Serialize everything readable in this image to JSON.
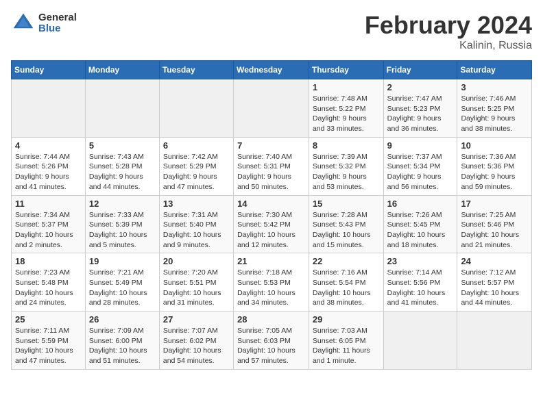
{
  "header": {
    "logo_general": "General",
    "logo_blue": "Blue",
    "title": "February 2024",
    "location": "Kalinin, Russia"
  },
  "weekdays": [
    "Sunday",
    "Monday",
    "Tuesday",
    "Wednesday",
    "Thursday",
    "Friday",
    "Saturday"
  ],
  "weeks": [
    [
      {
        "day": "",
        "info": ""
      },
      {
        "day": "",
        "info": ""
      },
      {
        "day": "",
        "info": ""
      },
      {
        "day": "",
        "info": ""
      },
      {
        "day": "1",
        "info": "Sunrise: 7:48 AM\nSunset: 5:22 PM\nDaylight: 9 hours\nand 33 minutes."
      },
      {
        "day": "2",
        "info": "Sunrise: 7:47 AM\nSunset: 5:23 PM\nDaylight: 9 hours\nand 36 minutes."
      },
      {
        "day": "3",
        "info": "Sunrise: 7:46 AM\nSunset: 5:25 PM\nDaylight: 9 hours\nand 38 minutes."
      }
    ],
    [
      {
        "day": "4",
        "info": "Sunrise: 7:44 AM\nSunset: 5:26 PM\nDaylight: 9 hours\nand 41 minutes."
      },
      {
        "day": "5",
        "info": "Sunrise: 7:43 AM\nSunset: 5:28 PM\nDaylight: 9 hours\nand 44 minutes."
      },
      {
        "day": "6",
        "info": "Sunrise: 7:42 AM\nSunset: 5:29 PM\nDaylight: 9 hours\nand 47 minutes."
      },
      {
        "day": "7",
        "info": "Sunrise: 7:40 AM\nSunset: 5:31 PM\nDaylight: 9 hours\nand 50 minutes."
      },
      {
        "day": "8",
        "info": "Sunrise: 7:39 AM\nSunset: 5:32 PM\nDaylight: 9 hours\nand 53 minutes."
      },
      {
        "day": "9",
        "info": "Sunrise: 7:37 AM\nSunset: 5:34 PM\nDaylight: 9 hours\nand 56 minutes."
      },
      {
        "day": "10",
        "info": "Sunrise: 7:36 AM\nSunset: 5:36 PM\nDaylight: 9 hours\nand 59 minutes."
      }
    ],
    [
      {
        "day": "11",
        "info": "Sunrise: 7:34 AM\nSunset: 5:37 PM\nDaylight: 10 hours\nand 2 minutes."
      },
      {
        "day": "12",
        "info": "Sunrise: 7:33 AM\nSunset: 5:39 PM\nDaylight: 10 hours\nand 5 minutes."
      },
      {
        "day": "13",
        "info": "Sunrise: 7:31 AM\nSunset: 5:40 PM\nDaylight: 10 hours\nand 9 minutes."
      },
      {
        "day": "14",
        "info": "Sunrise: 7:30 AM\nSunset: 5:42 PM\nDaylight: 10 hours\nand 12 minutes."
      },
      {
        "day": "15",
        "info": "Sunrise: 7:28 AM\nSunset: 5:43 PM\nDaylight: 10 hours\nand 15 minutes."
      },
      {
        "day": "16",
        "info": "Sunrise: 7:26 AM\nSunset: 5:45 PM\nDaylight: 10 hours\nand 18 minutes."
      },
      {
        "day": "17",
        "info": "Sunrise: 7:25 AM\nSunset: 5:46 PM\nDaylight: 10 hours\nand 21 minutes."
      }
    ],
    [
      {
        "day": "18",
        "info": "Sunrise: 7:23 AM\nSunset: 5:48 PM\nDaylight: 10 hours\nand 24 minutes."
      },
      {
        "day": "19",
        "info": "Sunrise: 7:21 AM\nSunset: 5:49 PM\nDaylight: 10 hours\nand 28 minutes."
      },
      {
        "day": "20",
        "info": "Sunrise: 7:20 AM\nSunset: 5:51 PM\nDaylight: 10 hours\nand 31 minutes."
      },
      {
        "day": "21",
        "info": "Sunrise: 7:18 AM\nSunset: 5:53 PM\nDaylight: 10 hours\nand 34 minutes."
      },
      {
        "day": "22",
        "info": "Sunrise: 7:16 AM\nSunset: 5:54 PM\nDaylight: 10 hours\nand 38 minutes."
      },
      {
        "day": "23",
        "info": "Sunrise: 7:14 AM\nSunset: 5:56 PM\nDaylight: 10 hours\nand 41 minutes."
      },
      {
        "day": "24",
        "info": "Sunrise: 7:12 AM\nSunset: 5:57 PM\nDaylight: 10 hours\nand 44 minutes."
      }
    ],
    [
      {
        "day": "25",
        "info": "Sunrise: 7:11 AM\nSunset: 5:59 PM\nDaylight: 10 hours\nand 47 minutes."
      },
      {
        "day": "26",
        "info": "Sunrise: 7:09 AM\nSunset: 6:00 PM\nDaylight: 10 hours\nand 51 minutes."
      },
      {
        "day": "27",
        "info": "Sunrise: 7:07 AM\nSunset: 6:02 PM\nDaylight: 10 hours\nand 54 minutes."
      },
      {
        "day": "28",
        "info": "Sunrise: 7:05 AM\nSunset: 6:03 PM\nDaylight: 10 hours\nand 57 minutes."
      },
      {
        "day": "29",
        "info": "Sunrise: 7:03 AM\nSunset: 6:05 PM\nDaylight: 11 hours\nand 1 minute."
      },
      {
        "day": "",
        "info": ""
      },
      {
        "day": "",
        "info": ""
      }
    ]
  ]
}
